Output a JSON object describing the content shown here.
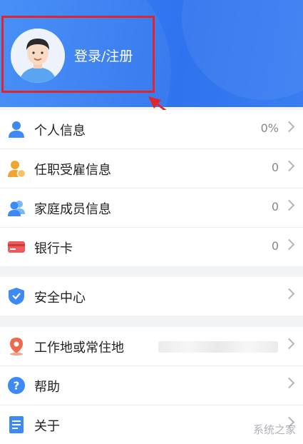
{
  "header": {
    "login_label": "登录/注册"
  },
  "group1": [
    {
      "label": "个人信息",
      "value": "0%",
      "icon": "user-icon"
    },
    {
      "label": "任职受雇信息",
      "value": "0",
      "icon": "employment-icon"
    },
    {
      "label": "家庭成员信息",
      "value": "0",
      "icon": "family-icon"
    },
    {
      "label": "银行卡",
      "value": "0",
      "icon": "bank-card-icon"
    }
  ],
  "group2": [
    {
      "label": "安全中心",
      "icon": "shield-icon"
    }
  ],
  "group3": [
    {
      "label": "工作地或常住地",
      "icon": "location-pin-icon"
    },
    {
      "label": "帮助",
      "icon": "help-icon"
    },
    {
      "label": "关于",
      "icon": "about-icon"
    }
  ],
  "watermark": "系统之家",
  "colors": {
    "header": "#2f73ee",
    "highlight_box": "#e0262b"
  }
}
